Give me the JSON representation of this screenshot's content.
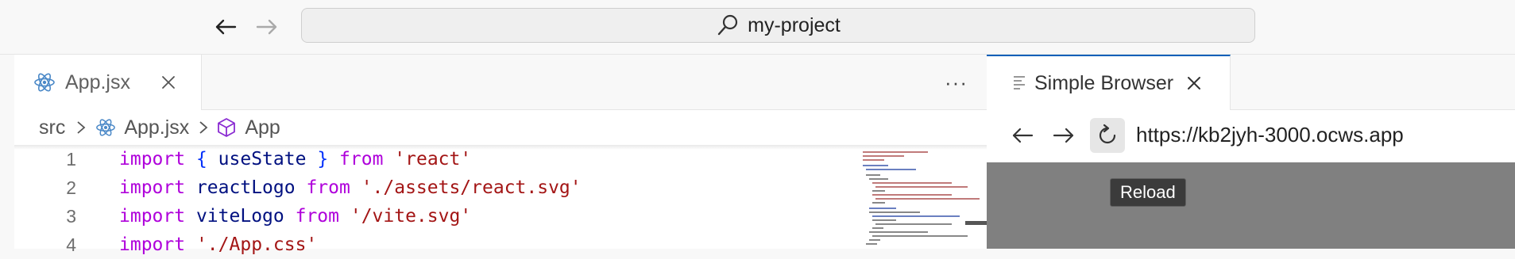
{
  "titlebar": {
    "back_icon": "arrow-left-icon",
    "forward_icon": "arrow-right-icon",
    "command_center_text": "my-project"
  },
  "editor": {
    "tab": {
      "label": "App.jsx",
      "icon": "react-icon"
    },
    "more_actions": "···",
    "breadcrumb": {
      "folder": "src",
      "file": "App.jsx",
      "symbol": "App"
    },
    "lines": [
      {
        "number": "1"
      },
      {
        "number": "2"
      },
      {
        "number": "3"
      },
      {
        "number": "4"
      }
    ],
    "code": {
      "l1": {
        "import": "import",
        "lb": "{",
        "name": "useState",
        "rb": "}",
        "from": "from",
        "str": "'react'"
      },
      "l2": {
        "import": "import",
        "name": "reactLogo",
        "from": "from",
        "str": "'./assets/react.svg'"
      },
      "l3": {
        "import": "import",
        "name": "viteLogo",
        "from": "from",
        "str": "'/vite.svg'"
      },
      "l4": {
        "import": "import",
        "str": "'./App.css'"
      }
    }
  },
  "browser": {
    "tab_label": "Simple Browser",
    "url": "https://kb2jyh-3000.ocws.app",
    "tooltip": "Reload"
  },
  "colors": {
    "accent": "#005fb8",
    "keyword": "#af00db",
    "identifier": "#001080",
    "string": "#a31515"
  }
}
